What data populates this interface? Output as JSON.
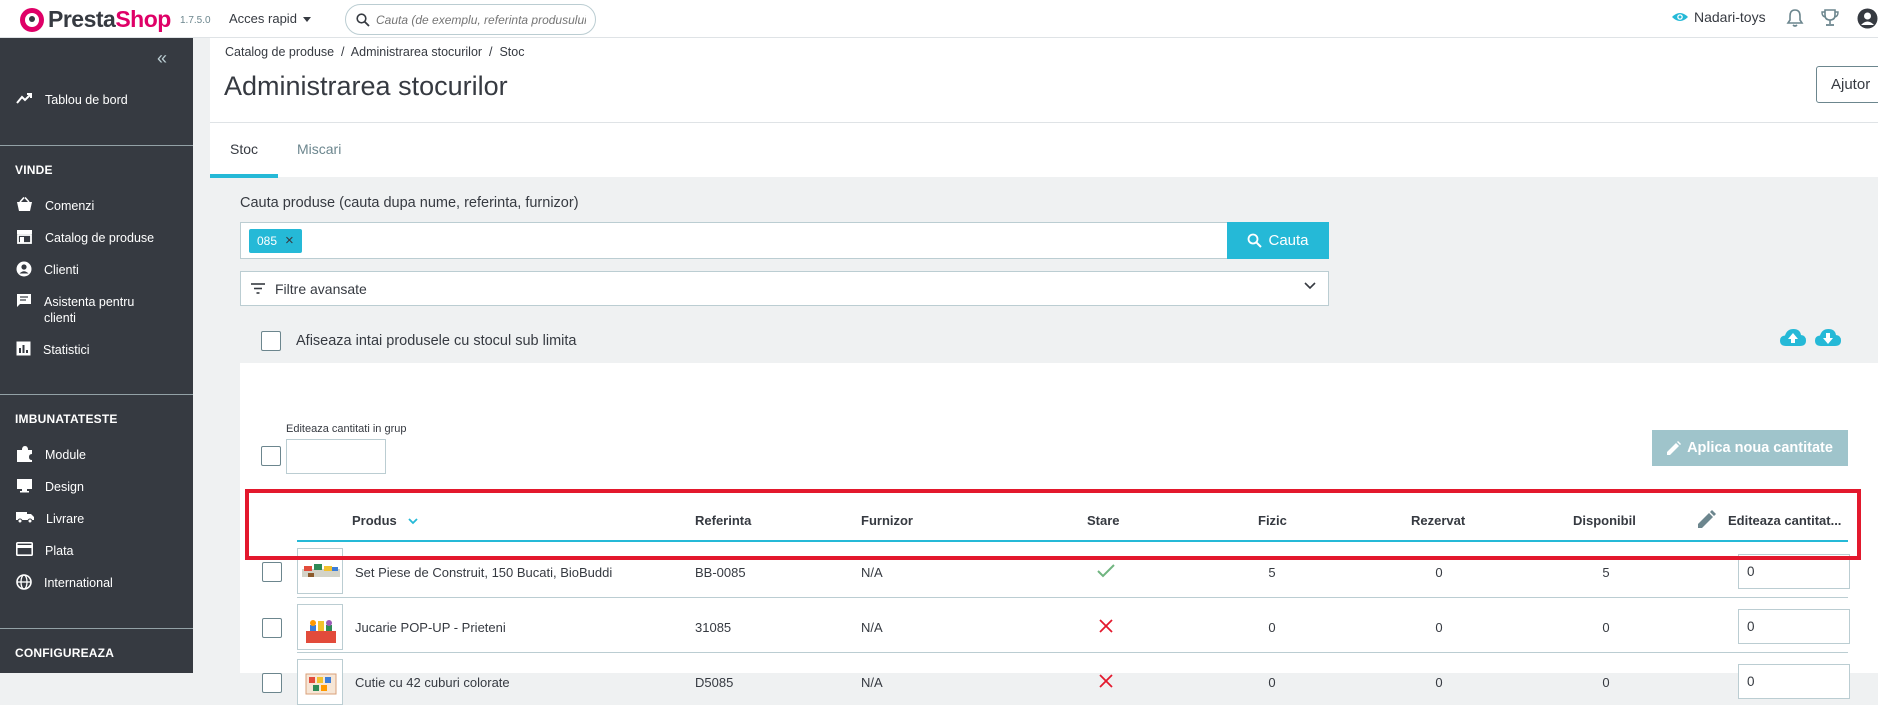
{
  "topbar": {
    "logo_a": "Presta",
    "logo_b": "Shop",
    "version": "1.7.5.0",
    "quick_access": "Acces rapid",
    "search_placeholder": "Cauta (de exemplu, referinta produsului",
    "shop_name": "Nadari-toys"
  },
  "sidebar": {
    "dashboard": "Tablou de bord",
    "section_sell": "VINDE",
    "sell_items": [
      "Comenzi",
      "Catalog de produse",
      "Clienti",
      "Asistenta pentru clienti",
      "Statistici"
    ],
    "section_improve": "IMBUNATATESTE",
    "improve_items": [
      "Module",
      "Design",
      "Livrare",
      "Plata",
      "International"
    ],
    "section_configure": "CONFIGUREAZA"
  },
  "header": {
    "breadcrumb": "Catalog de produse  /  Administrarea stocurilor  /  Stoc",
    "title": "Administrarea stocurilor",
    "help_button": "Ajutor"
  },
  "tabs": [
    "Stoc",
    "Miscari"
  ],
  "search": {
    "label": "Cauta produse (cauta dupa nume, referinta, furnizor)",
    "tag": "085",
    "button": "Cauta",
    "advanced_filters": "Filtre avansate"
  },
  "low_stock_label": "Afiseaza intai produsele cu stocul sub limita",
  "bulk": {
    "label": "Editeaza cantitati in grup",
    "apply_button": "Aplica noua cantitate"
  },
  "table": {
    "headers": {
      "product": "Produs",
      "reference": "Referinta",
      "supplier": "Furnizor",
      "status": "Stare",
      "physical": "Fizic",
      "reserved": "Rezervat",
      "available": "Disponibil",
      "edit_quantity": "Editeaza cantitat..."
    },
    "rows": [
      {
        "name": "Set Piese de Construit, 150 Bucati, BioBuddi",
        "reference": "BB-0085",
        "supplier": "N/A",
        "active": true,
        "physical": "5",
        "reserved": "0",
        "available": "5",
        "quantity": "0"
      },
      {
        "name": "Jucarie POP-UP - Prieteni",
        "reference": "31085",
        "supplier": "N/A",
        "active": false,
        "physical": "0",
        "reserved": "0",
        "available": "0",
        "quantity": "0"
      },
      {
        "name": "Cutie cu 42 cuburi colorate",
        "reference": "D5085",
        "supplier": "N/A",
        "active": false,
        "physical": "0",
        "reserved": "0",
        "available": "0",
        "quantity": "0"
      }
    ]
  },
  "colors": {
    "accent": "#25b9d7",
    "sidebar": "#363a41",
    "brand": "#df0067",
    "success": "#70b580",
    "danger": "#e3182d"
  }
}
